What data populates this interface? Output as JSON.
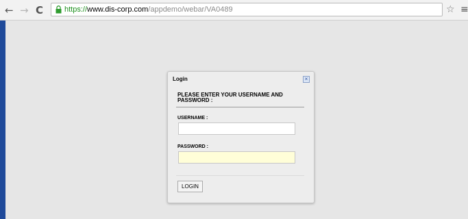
{
  "browser": {
    "url_scheme": "https://",
    "url_host": "www.dis-corp.com",
    "url_path": "/appdemo/webar/VA0489",
    "back_icon": "←",
    "forward_icon": "→",
    "reload_icon": "C",
    "star_icon": "☆",
    "menu_icon": "≡"
  },
  "dialog": {
    "title": "Login",
    "close_icon": "×",
    "instruction": "PLEASE ENTER YOUR USERNAME AND PASSWORD :",
    "username_label": "USERNAME :",
    "username_value": "",
    "password_label": "PASSWORD :",
    "password_value": "",
    "login_label": "LOGIN"
  },
  "colors": {
    "page_bg": "#e6e6e6",
    "left_bar": "#1f4a9a",
    "https_green": "#1b8f1b",
    "password_bg": "#fffed8"
  }
}
